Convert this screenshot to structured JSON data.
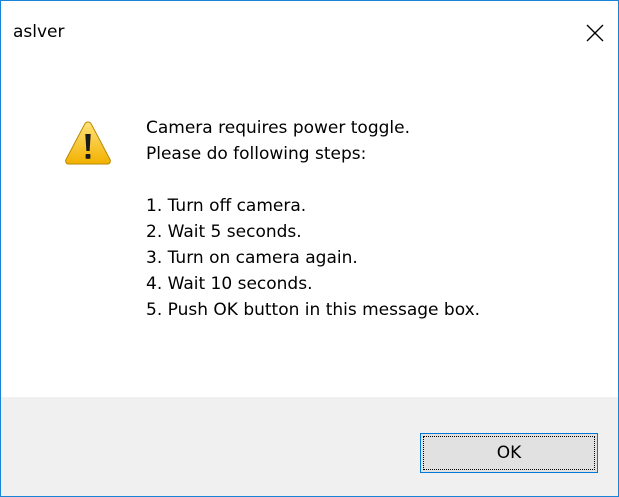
{
  "window": {
    "title": "aslver"
  },
  "icons": {
    "warning": "warning-triangle-icon",
    "close": "close-x-icon"
  },
  "message": {
    "lines": [
      "Camera requires power toggle.",
      "Please do following steps:",
      "",
      "1. Turn off camera.",
      "2. Wait 5 seconds.",
      "3. Turn on camera again.",
      "4. Wait 10 seconds.",
      "5. Push OK button in this message box."
    ]
  },
  "buttons": {
    "ok_label": "OK"
  },
  "colors": {
    "window_border": "#1883d7",
    "footer_bg": "#f0f0f0",
    "button_bg": "#e1e1e1",
    "button_border_focus": "#0078d7",
    "warning_fill": "#f7c21c"
  }
}
